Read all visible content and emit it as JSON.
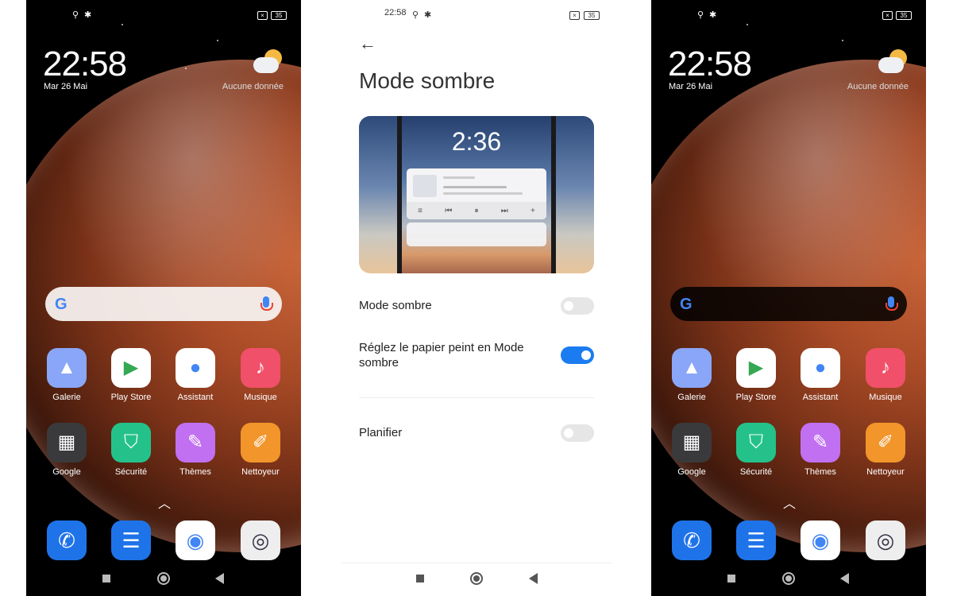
{
  "status_bar": {
    "time": "22:58",
    "battery": "35",
    "sim": "×"
  },
  "lockscreen": {
    "clock": "22:58",
    "date": "Mar 26 Mai",
    "weather_text": "Aucune donnée",
    "weather_icon": "partly-cloudy-icon"
  },
  "search": {
    "google_glyph": "G",
    "mic_icon": "microphone-icon"
  },
  "apps": [
    {
      "label": "Galerie",
      "icon": "gallery-icon",
      "bg": "#8aa6f8"
    },
    {
      "label": "Play Store",
      "icon": "play-store-icon",
      "bg": "#ffffff"
    },
    {
      "label": "Assistant",
      "icon": "assistant-icon",
      "bg": "#ffffff"
    },
    {
      "label": "Musique",
      "icon": "music-icon",
      "bg": "#f0506a"
    },
    {
      "label": "Google",
      "icon": "google-folder-icon",
      "bg": "#3a3a3c"
    },
    {
      "label": "Sécurité",
      "icon": "security-shield-icon",
      "bg": "#24c28a"
    },
    {
      "label": "Thèmes",
      "icon": "themes-brush-icon",
      "bg": "#c070f0"
    },
    {
      "label": "Nettoyeur",
      "icon": "cleaner-brush-icon",
      "bg": "#f2952a"
    }
  ],
  "dock": [
    {
      "icon": "phone-icon",
      "bg": "#1f73e8"
    },
    {
      "icon": "messages-icon",
      "bg": "#1f73e8"
    },
    {
      "icon": "chrome-icon",
      "bg": "#ffffff"
    },
    {
      "icon": "camera-icon",
      "bg": "#eeeeee"
    }
  ],
  "settings": {
    "back_glyph": "←",
    "title": "Mode sombre",
    "preview": {
      "time": "2:36",
      "controls": [
        "≡",
        "⏮",
        "⏸",
        "⏭",
        "+"
      ]
    },
    "rows": [
      {
        "label": "Mode sombre",
        "enabled": false
      },
      {
        "label": "Réglez le papier peint en Mode sombre",
        "enabled": true
      },
      {
        "label": "Planifier",
        "enabled": false
      }
    ],
    "accent": "#1a7cf0"
  }
}
